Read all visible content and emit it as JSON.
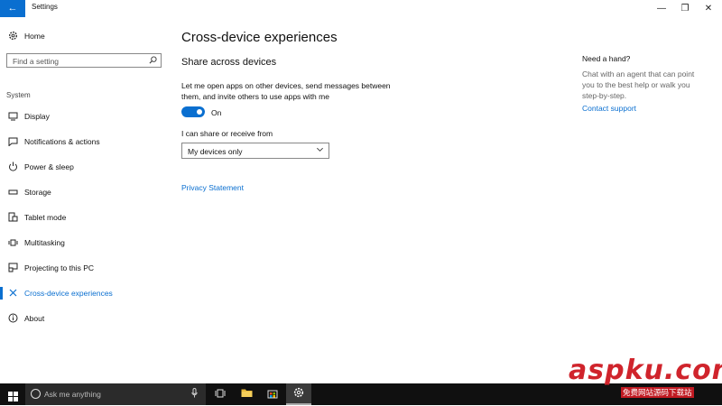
{
  "window": {
    "title": "Settings",
    "back_icon": "←",
    "minimize": "—",
    "restore": "❐",
    "close": "✕"
  },
  "sidebar": {
    "home": "Home",
    "search_placeholder": "Find a setting",
    "section": "System",
    "items": [
      {
        "label": "Display",
        "icon": "display-icon"
      },
      {
        "label": "Notifications & actions",
        "icon": "notifications-icon"
      },
      {
        "label": "Power & sleep",
        "icon": "power-icon"
      },
      {
        "label": "Storage",
        "icon": "storage-icon"
      },
      {
        "label": "Tablet mode",
        "icon": "tablet-icon"
      },
      {
        "label": "Multitasking",
        "icon": "multitasking-icon"
      },
      {
        "label": "Projecting to this PC",
        "icon": "projecting-icon"
      },
      {
        "label": "Cross-device experiences",
        "icon": "cross-device-icon",
        "active": true
      },
      {
        "label": "About",
        "icon": "info-icon"
      }
    ]
  },
  "main": {
    "title": "Cross-device experiences",
    "subtitle": "Share across devices",
    "description": "Let me open apps on other devices, send messages between them, and invite others to use apps with me",
    "toggle_state": "On",
    "share_label": "I can share or receive from",
    "dropdown_value": "My devices only",
    "privacy_link": "Privacy Statement"
  },
  "help": {
    "title": "Need a hand?",
    "text": "Chat with an agent that can point you to the best help or walk you step-by-step.",
    "link": "Contact support"
  },
  "taskbar": {
    "search_placeholder": "Ask me anything"
  },
  "watermark": {
    "main": "aspku.com",
    "sub": "免费网站源码下载站"
  },
  "colors": {
    "accent": "#0a6fd0",
    "taskbar": "#101010"
  }
}
